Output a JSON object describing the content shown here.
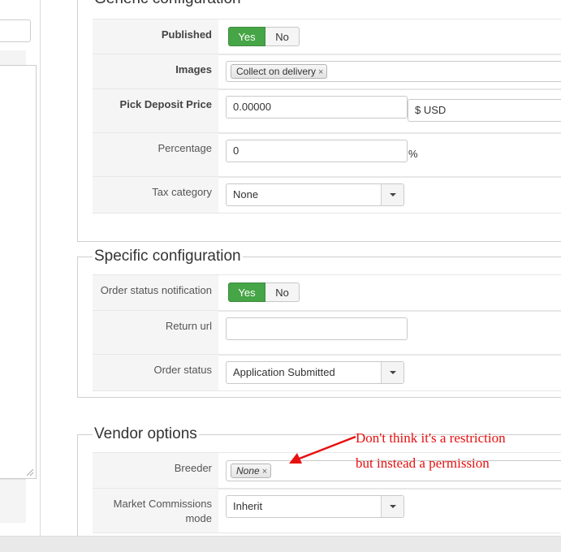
{
  "generic": {
    "legend": "Generic configuration",
    "published": {
      "label": "Published",
      "yes": "Yes",
      "no": "No",
      "selected": "Yes"
    },
    "images": {
      "label": "Images",
      "tag": "Collect on delivery"
    },
    "pick_deposit_price": {
      "label": "Pick Deposit Price",
      "value": "0.00000",
      "currency": "$ USD"
    },
    "percentage": {
      "label": "Percentage",
      "value": "0",
      "suffix": "%"
    },
    "tax_category": {
      "label": "Tax category",
      "value": "None"
    }
  },
  "specific": {
    "legend": "Specific configuration",
    "order_status_notification": {
      "label": "Order status notification",
      "yes": "Yes",
      "no": "No",
      "selected": "Yes"
    },
    "return_url": {
      "label": "Return url",
      "value": ""
    },
    "order_status": {
      "label": "Order status",
      "value": "Application Submitted"
    }
  },
  "vendor": {
    "legend": "Vendor options",
    "breeder": {
      "label": "Breeder",
      "tag": "None"
    },
    "market_commissions_mode": {
      "label": "Market Commissions mode",
      "value": "Inherit"
    }
  },
  "annotation": {
    "line1": "Don't think it's a restriction",
    "line2": "but instead a permission",
    "color": "#e81010"
  },
  "colors": {
    "toggle_active": "#46a546",
    "label_bg": "#f5f5f5"
  },
  "icons": {
    "tag_remove": "×",
    "select_arrow": "caret-down"
  }
}
